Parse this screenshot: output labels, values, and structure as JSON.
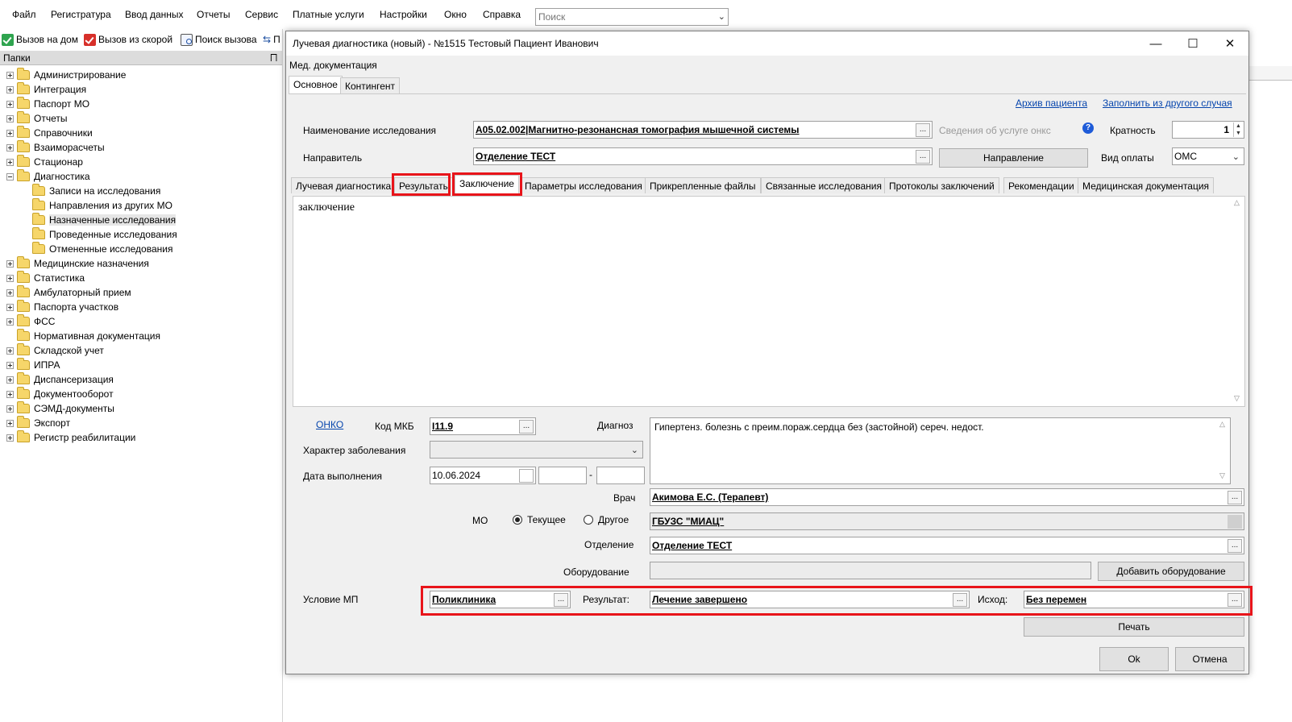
{
  "menu": {
    "items": [
      "Файл",
      "Регистратура",
      "Ввод данных",
      "Отчеты",
      "Сервис",
      "Платные услуги",
      "Настройки",
      "Окно",
      "Справка"
    ],
    "search_placeholder": "Поиск"
  },
  "toolbar": {
    "home_call": "Вызов на дом",
    "ambulance_call": "Вызов из скорой",
    "find_call": "Поиск вызова",
    "truncated": "П"
  },
  "folders": {
    "title": "Папки",
    "pin": "⨅",
    "items": [
      {
        "label": "Администрирование",
        "level": 0,
        "expander": "plus"
      },
      {
        "label": "Интеграция",
        "level": 0,
        "expander": "plus"
      },
      {
        "label": "Паспорт МО",
        "level": 0,
        "expander": "plus"
      },
      {
        "label": "Отчеты",
        "level": 0,
        "expander": "plus"
      },
      {
        "label": "Справочники",
        "level": 0,
        "expander": "plus"
      },
      {
        "label": "Взаиморасчеты",
        "level": 0,
        "expander": "plus"
      },
      {
        "label": "Стационар",
        "level": 0,
        "expander": "plus"
      },
      {
        "label": "Диагностика",
        "level": 0,
        "expander": "minus"
      },
      {
        "label": "Записи на исследования",
        "level": 1,
        "expander": "none"
      },
      {
        "label": "Направления из других МО",
        "level": 1,
        "expander": "none"
      },
      {
        "label": "Назначенные исследования",
        "level": 1,
        "expander": "none",
        "selected": true
      },
      {
        "label": "Проведенные исследования",
        "level": 1,
        "expander": "none"
      },
      {
        "label": "Отмененные исследования",
        "level": 1,
        "expander": "none"
      },
      {
        "label": "Медицинские назначения",
        "level": 0,
        "expander": "plus"
      },
      {
        "label": "Статистика",
        "level": 0,
        "expander": "plus"
      },
      {
        "label": "Амбулаторный прием",
        "level": 0,
        "expander": "plus"
      },
      {
        "label": "Паспорта участков",
        "level": 0,
        "expander": "plus"
      },
      {
        "label": "ФСС",
        "level": 0,
        "expander": "plus"
      },
      {
        "label": "Нормативная документация",
        "level": 0,
        "expander": "none"
      },
      {
        "label": "Складской учет",
        "level": 0,
        "expander": "plus"
      },
      {
        "label": "ИПРА",
        "level": 0,
        "expander": "plus"
      },
      {
        "label": "Диспансеризация",
        "level": 0,
        "expander": "plus"
      },
      {
        "label": "Документооборот",
        "level": 0,
        "expander": "plus"
      },
      {
        "label": "СЭМД-документы",
        "level": 0,
        "expander": "plus"
      },
      {
        "label": "Экспорт",
        "level": 0,
        "expander": "plus"
      },
      {
        "label": "Регистр реабилитации",
        "level": 0,
        "expander": "plus"
      }
    ]
  },
  "dialog": {
    "title": "Лучевая диагностика (новый) - №1515 Тестовый Пациент Иванович",
    "minimize": "—",
    "maximize": "☐",
    "close": "✕",
    "menu": "Мед. документация",
    "tabs": [
      "Основное",
      "Контингент"
    ],
    "archive_link": "Архив пациента",
    "fill_link": "Заполнить из другого случая",
    "study_label": "Наименование исследования",
    "study_value": "A05.02.002|Магнитно-резонансная томография мышечной системы",
    "service_info": "Сведения об услуге онкс",
    "multiplicity_label": "Кратность",
    "multiplicity_value": "1",
    "referrer_label": "Направитель",
    "referrer_value": "Отделение ТЕСТ",
    "referral_button": "Направление",
    "payment_label": "Вид оплаты",
    "payment_value": "ОМС",
    "subtabs": [
      "Лучевая диагностика",
      "Результаты",
      "Заключение",
      "Параметры исследования",
      "Прикрепленные файлы",
      "Связанные исследования",
      "Протоколы заключений",
      "Рекомендации",
      "Медицинская документация"
    ],
    "conclusion_text": "заключение",
    "onko_link": "ОНКО",
    "mkb_label": "Код МКБ",
    "mkb_value": "I11.9",
    "diagnosis_label": "Диагноз",
    "diagnosis_text": "Гипертенз. болезнь с преим.пораж.сердца без (застойной) сереч. недост.",
    "character_label": "Характер заболевания",
    "date_label": "Дата выполнения",
    "date_value": "10.06.2024",
    "dash": "-",
    "doctor_label": "Врач",
    "doctor_value": "Акимова Е.С. (Терапевт)",
    "mo_label": "МО",
    "mo_current": "Текущее",
    "mo_other": "Другое",
    "mo_value": "ГБУЗС \"МИАЦ\"",
    "department_label": "Отделение",
    "department_value": "Отделение ТЕСТ",
    "equipment_label": "Оборудование",
    "add_equipment": "Добавить оборудование",
    "condition_label": "Условие МП",
    "condition_value": "Поликлиника",
    "result_label": "Результат:",
    "result_value": "Лечение завершено",
    "outcome_label": "Исход:",
    "outcome_value": "Без перемен",
    "print_button": "Печать",
    "ok_button": "Ok",
    "cancel_button": "Отмена",
    "ellipsis": "...",
    "help": "?"
  }
}
